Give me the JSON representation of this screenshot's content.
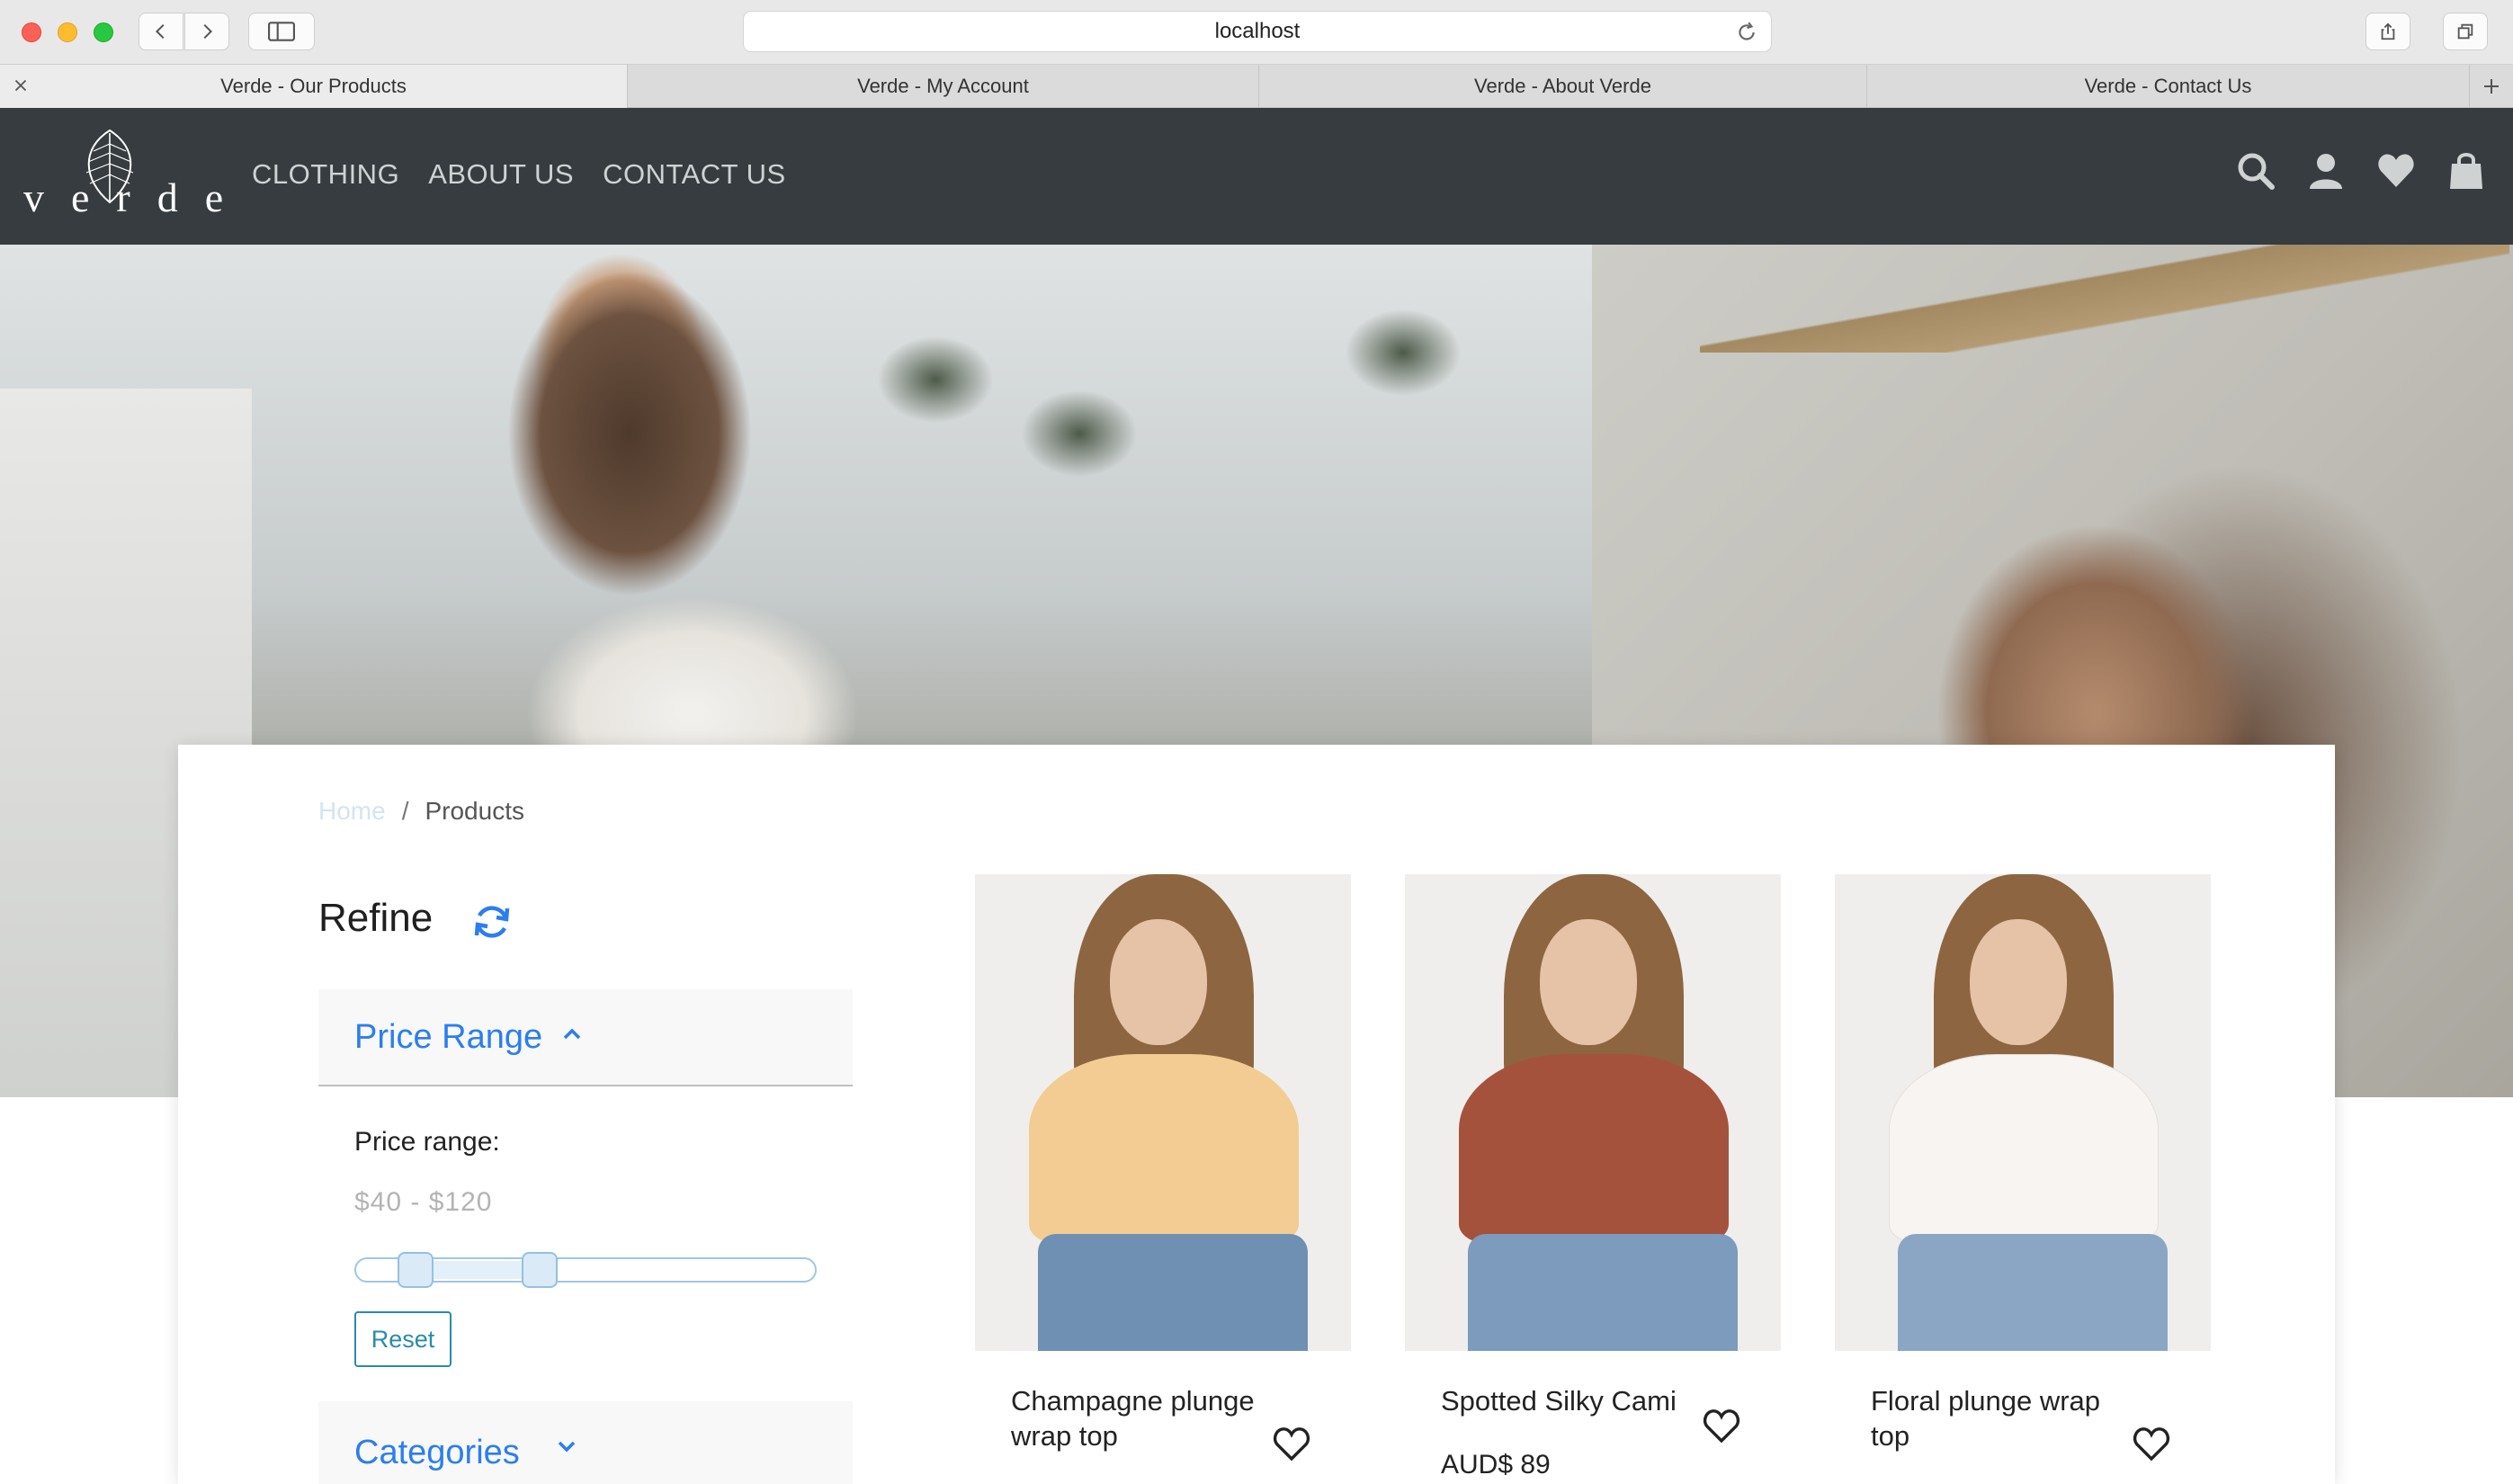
{
  "browser": {
    "url": "localhost",
    "tabs": [
      {
        "label": "Verde - Our Products",
        "active": true
      },
      {
        "label": "Verde - My Account",
        "active": false
      },
      {
        "label": "Verde - About Verde",
        "active": false
      },
      {
        "label": "Verde - Contact Us",
        "active": false
      }
    ]
  },
  "header": {
    "logo_text": "verde",
    "nav": [
      "CLOTHING",
      "ABOUT US",
      "CONTACT US"
    ],
    "icons": [
      "search-icon",
      "user-icon",
      "heart-icon",
      "shopping-bag-icon"
    ],
    "background": "#363c3f"
  },
  "breadcrumb": {
    "home": "Home",
    "separator": "/",
    "current": "Products"
  },
  "refine": {
    "title": "Refine",
    "price_panel": {
      "title": "Price Range",
      "label": "Price range:",
      "value_text": "$40 - $120",
      "range_low_fraction": 0.13,
      "range_high_fraction": 0.4,
      "reset_label": "Reset"
    },
    "categories_panel": {
      "title": "Categories"
    },
    "accent": "#2a7ef0"
  },
  "products": [
    {
      "name": "Champagne plunge wrap top",
      "price": ""
    },
    {
      "name": "Spotted Silky Cami",
      "price": "AUD$ 89"
    },
    {
      "name": "Floral plunge wrap top",
      "price": ""
    }
  ]
}
